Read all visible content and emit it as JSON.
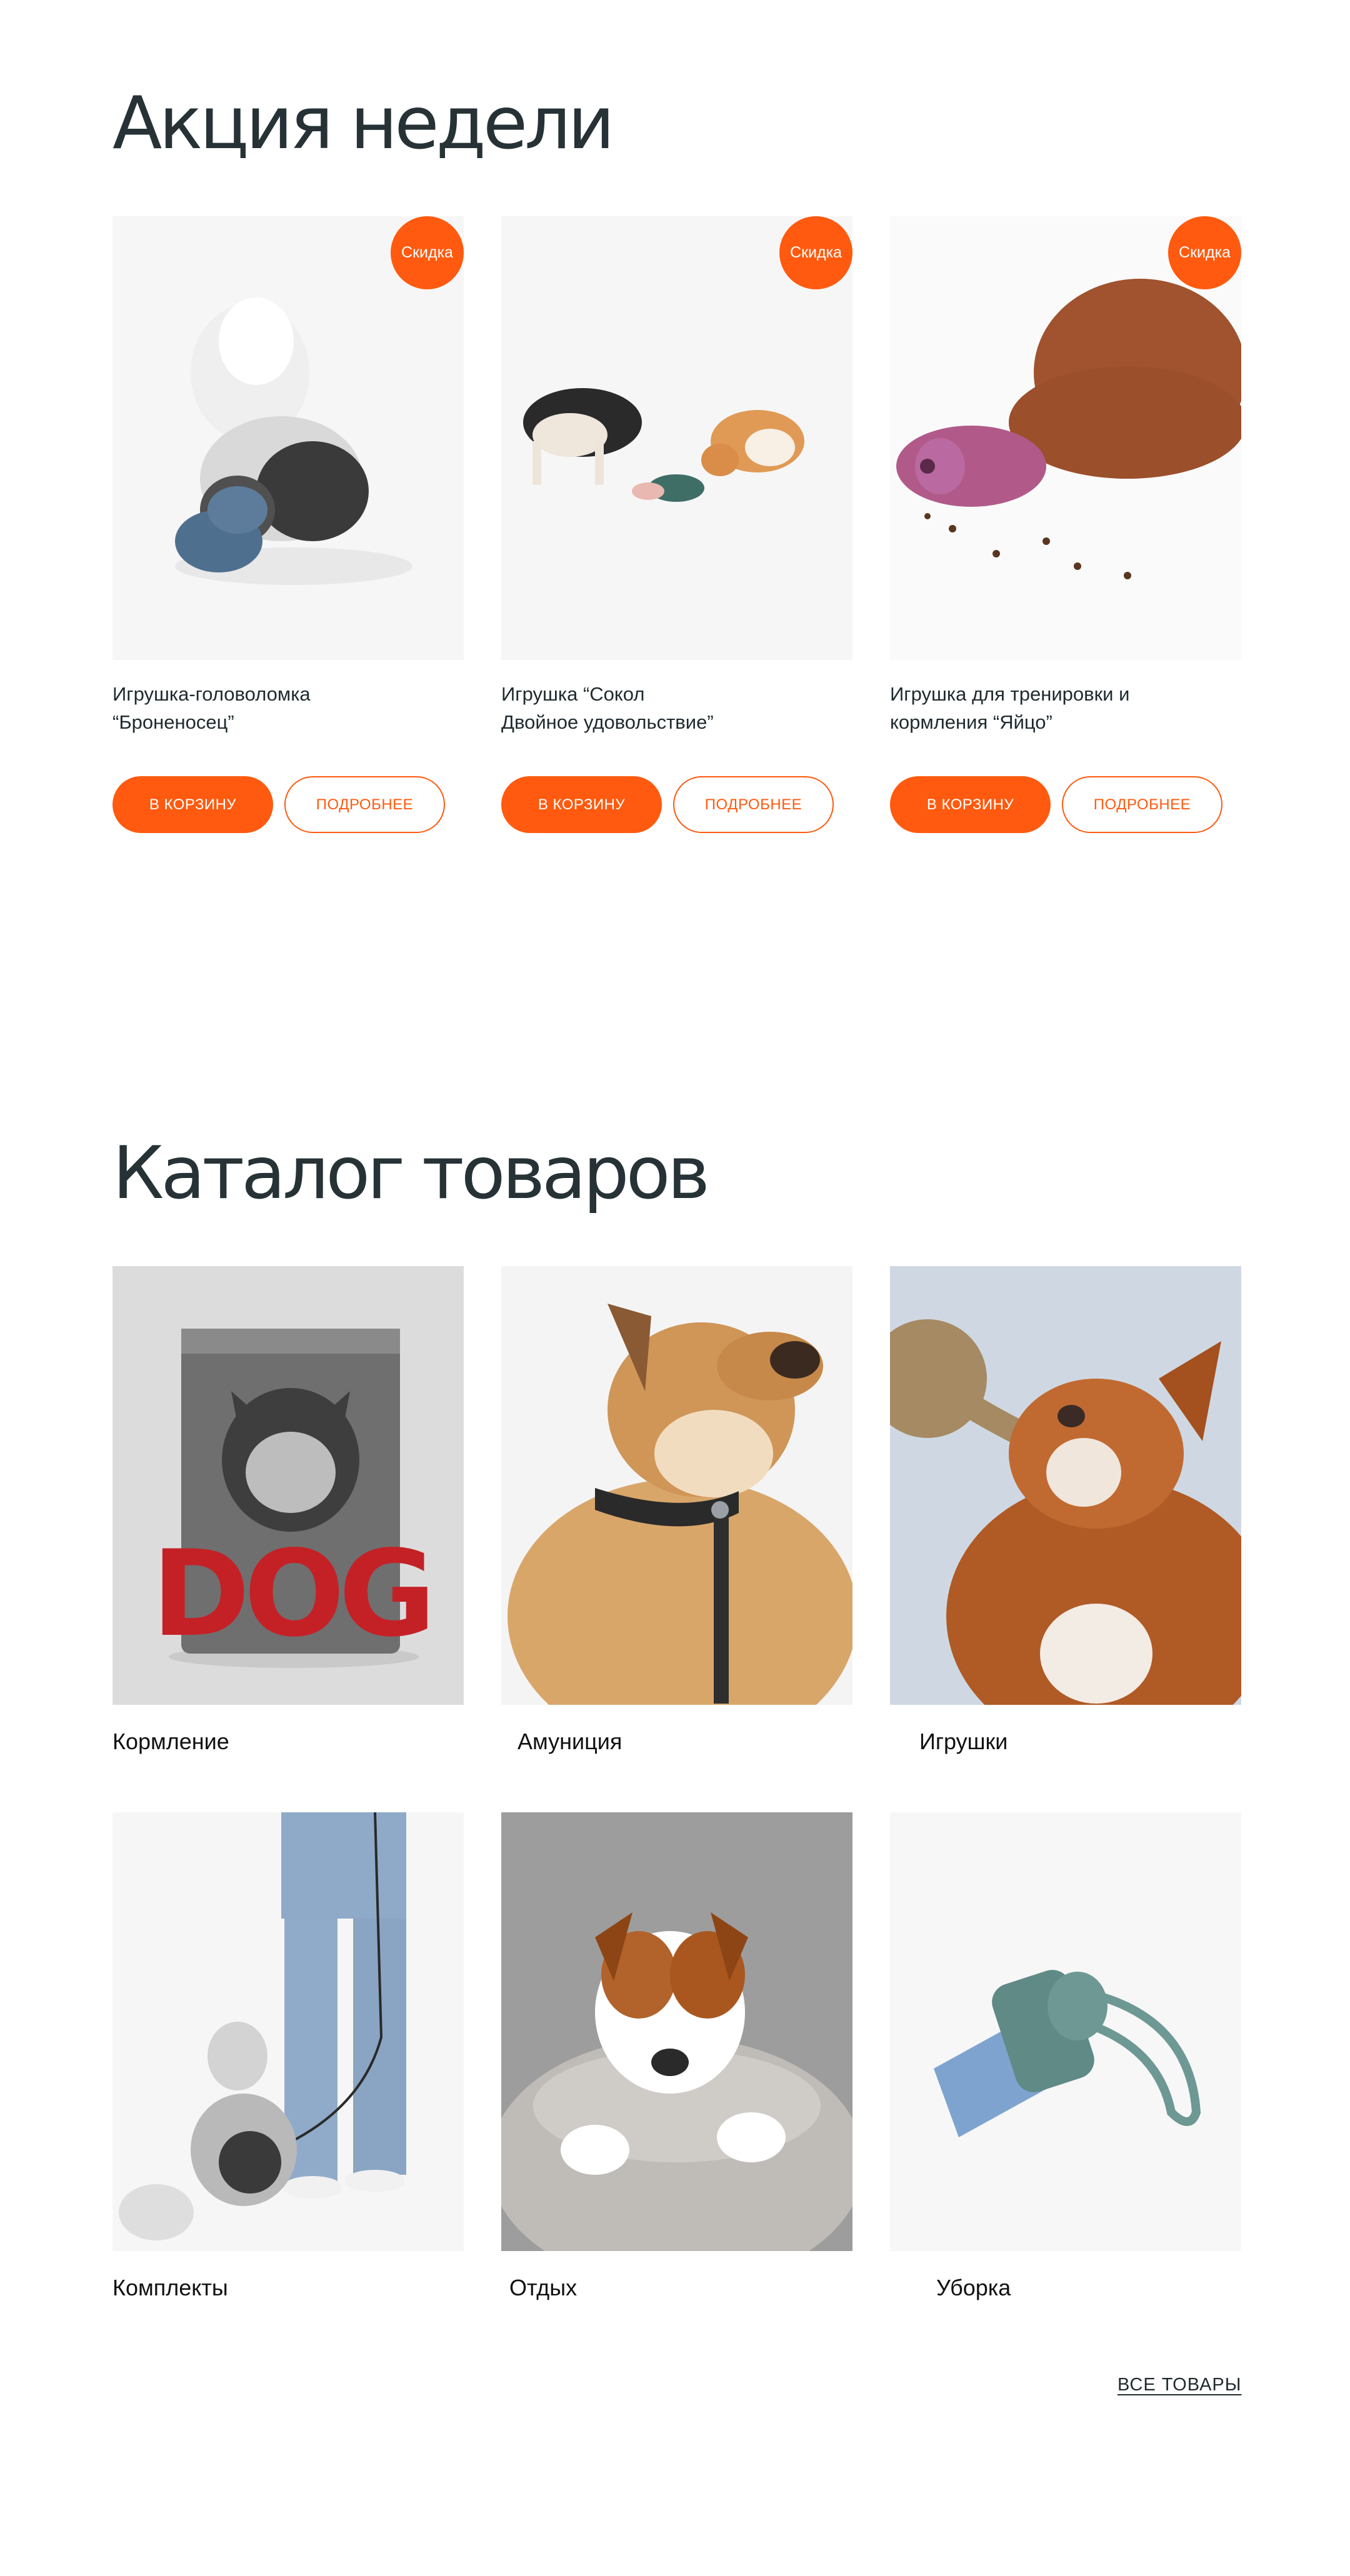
{
  "promo": {
    "title": "Акция недели",
    "items": [
      {
        "badge": "Скидка",
        "name": "Игрушка-головоломка\n“Броненосец”",
        "cart_label": "В КОРЗИНУ",
        "details_label": "ПОДРОБНЕЕ"
      },
      {
        "badge": "Скидка",
        "name": "Игрушка “Сокол\nДвойное удовольствие”",
        "cart_label": "В КОРЗИНУ",
        "details_label": "ПОДРОБНЕЕ"
      },
      {
        "badge": "Скидка",
        "name": "Игрушка для тренировки и\nкормления “Яйцо”",
        "cart_label": "В КОРЗИНУ",
        "details_label": "ПОДРОБНЕЕ"
      }
    ]
  },
  "catalog": {
    "title": "Каталог товаров",
    "categories": [
      {
        "label": "Кормление"
      },
      {
        "label": "Амуниция"
      },
      {
        "label": "Игрушки"
      },
      {
        "label": "Комплекты"
      },
      {
        "label": "Отдых"
      },
      {
        "label": "Уборка"
      }
    ],
    "all_link": "ВСЕ ТОВАРЫ",
    "bag_text": "DOG"
  },
  "colors": {
    "accent": "#ff5a0f",
    "heading": "#263236",
    "text": "#1f2a2e"
  }
}
